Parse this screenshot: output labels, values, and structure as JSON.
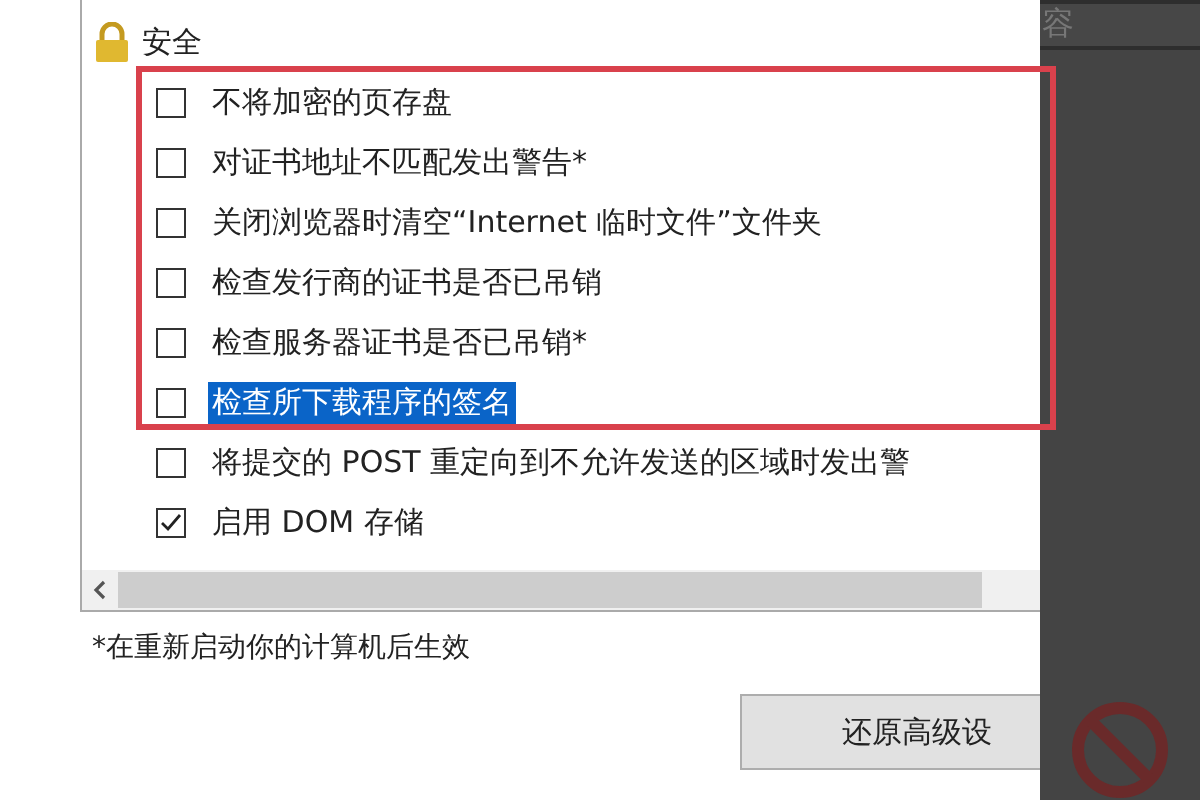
{
  "settings_list": {
    "group": {
      "title": "安全"
    },
    "items": [
      {
        "label": "不将加密的页存盘",
        "checked": false,
        "selected": false
      },
      {
        "label": "对证书地址不匹配发出警告*",
        "checked": false,
        "selected": false
      },
      {
        "label": "关闭浏览器时清空“Internet 临时文件”文件夹",
        "checked": false,
        "selected": false
      },
      {
        "label": "检查发行商的证书是否已吊销",
        "checked": false,
        "selected": false
      },
      {
        "label": "检查服务器证书是否已吊销*",
        "checked": false,
        "selected": false
      },
      {
        "label": "检查所下载程序的签名",
        "checked": false,
        "selected": true
      },
      {
        "label": "将提交的 POST 重定向到不允许发送的区域时发出警",
        "checked": false,
        "selected": false
      },
      {
        "label": "启用 DOM 存储",
        "checked": true,
        "selected": false
      }
    ]
  },
  "footnote": "*在重新启动你的计算机后生效",
  "restore_button": "还原高级设",
  "side_panel": {
    "item_text": "容"
  }
}
